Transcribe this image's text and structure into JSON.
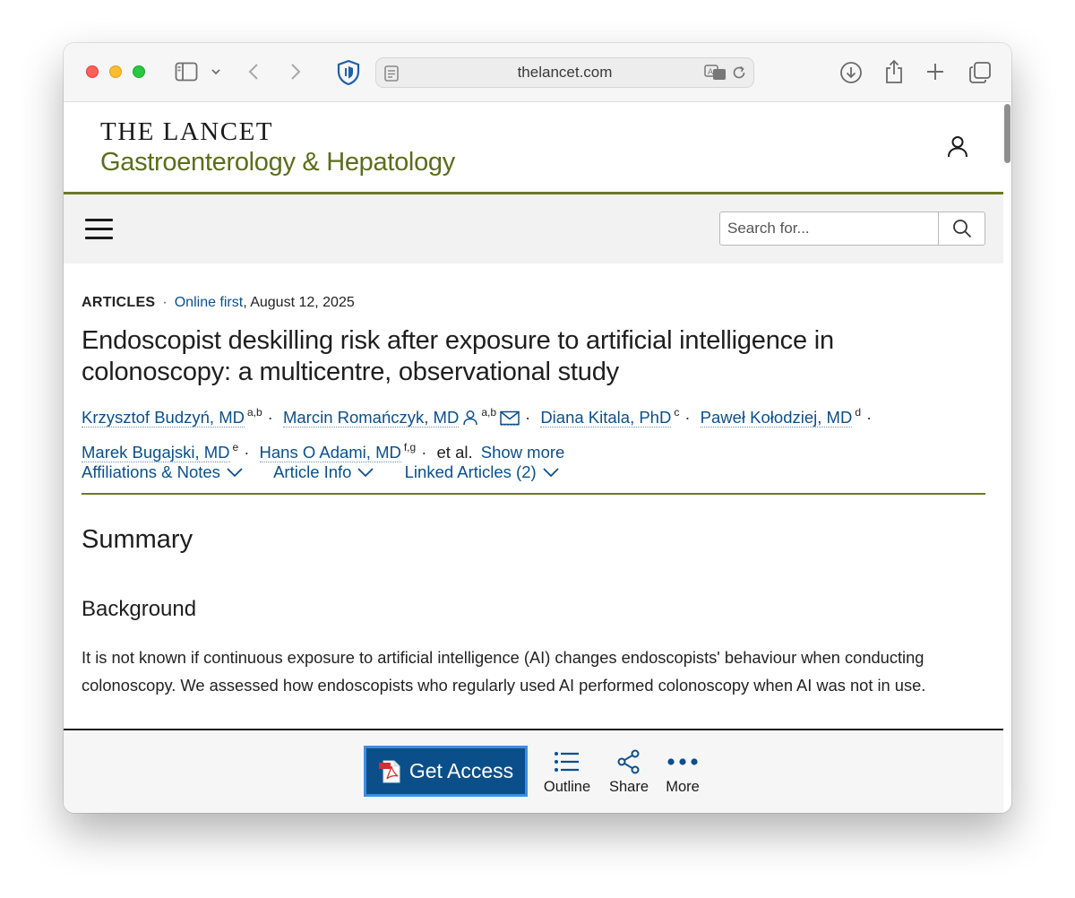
{
  "browser": {
    "url": "thelancet.com"
  },
  "site": {
    "brand": "THE LANCET",
    "journal": "Gastroenterology & Hepatology"
  },
  "search": {
    "placeholder": "Search for..."
  },
  "article": {
    "type": "ARTICLES",
    "status": "Online first",
    "date": ", August 12, 2025",
    "title": "Endoscopist deskilling risk after exposure to artificial intelligence in colonoscopy: a multicentre, observational study",
    "authors": [
      {
        "name": "Krzysztof Budzyń, MD",
        "sup": "a,b"
      },
      {
        "name": "Marcin Romańczyk, MD",
        "sup": "a,b"
      },
      {
        "name": "Diana Kitala, PhD",
        "sup": "c"
      },
      {
        "name": "Paweł Kołodziej, MD",
        "sup": "d"
      },
      {
        "name": "Marek Bugajski, MD",
        "sup": "e"
      },
      {
        "name": "Hans O Adami, MD",
        "sup": "f,g"
      }
    ],
    "et_al": "et al.",
    "show_more": "Show more",
    "tabs": [
      "Affiliations & Notes",
      "Article Info",
      "Linked Articles (2)"
    ]
  },
  "summary": {
    "heading": "Summary",
    "background_heading": "Background",
    "background_text": "It is not known if continuous exposure to artificial intelligence (AI) changes endoscopists' behaviour when conducting colonoscopy. We assessed how endoscopists who regularly used AI performed colonoscopy when AI was not in use."
  },
  "actions": {
    "get_access": "Get Access",
    "outline": "Outline",
    "share": "Share",
    "more": "More"
  },
  "colors": {
    "link": "#0b4f8a",
    "journal_green": "#5b6d1c",
    "rule_olive": "#6b7a24",
    "button_blue": "#0b4f8a"
  }
}
